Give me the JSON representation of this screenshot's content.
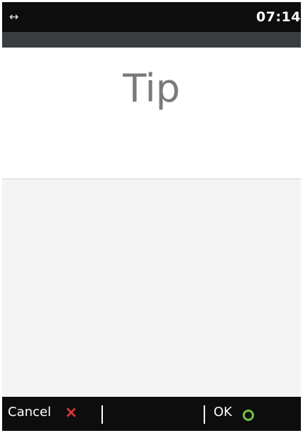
{
  "status_bar": {
    "connection_icon": "↔",
    "time": "07:14"
  },
  "screen": {
    "title": "Tip"
  },
  "softkeys": {
    "cancel_label": "Cancel",
    "cancel_icon": "×",
    "ok_label": "OK"
  },
  "colors": {
    "cancel_icon": "#e53935",
    "ok_icon": "#76c043"
  }
}
